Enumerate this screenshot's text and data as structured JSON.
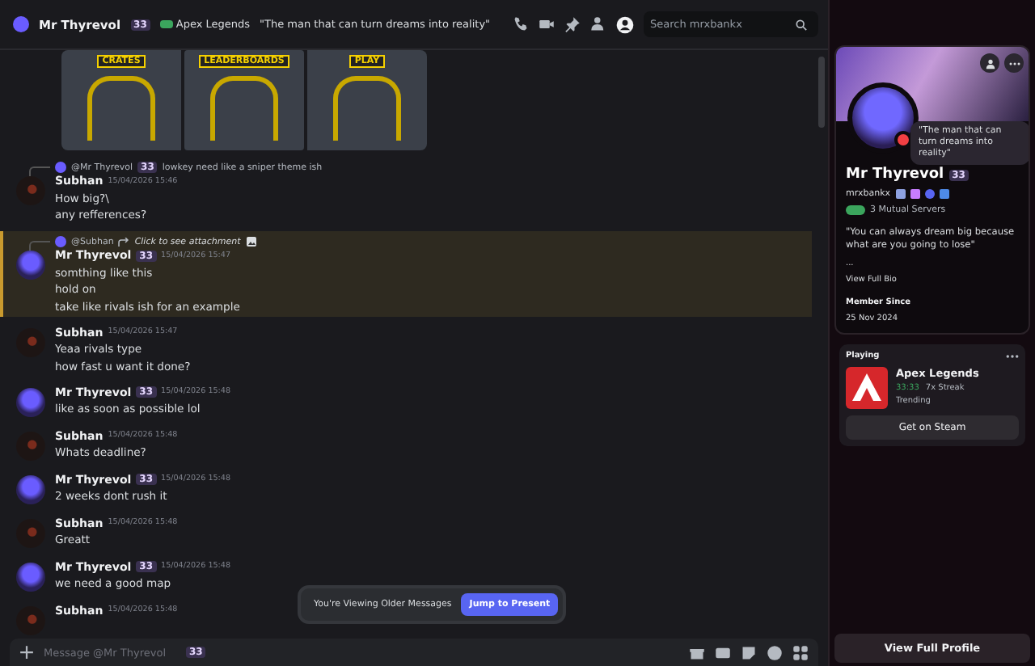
{
  "header": {
    "name": "Mr Thyrevol",
    "tag": "33",
    "game": "Apex Legends",
    "status": "\"The man that can turn dreams into reality\"",
    "search": {
      "placeholder": "Search mrxbankx"
    }
  },
  "attachments": [
    {
      "caption": "CRATES"
    },
    {
      "caption": "LEADERBOARDS"
    },
    {
      "caption": "PLAY"
    }
  ],
  "messages": [
    {
      "author": "Subhan",
      "kind": "dark",
      "time": "15/04/2026 15:46",
      "highlighted": false,
      "reply": {
        "author": "@Mr Thyrevol",
        "tag": "33",
        "text": "lowkey need like a sniper theme ish",
        "kind": "text"
      },
      "lines": [
        "How big?\\",
        "any refferences?"
      ]
    },
    {
      "author": "Mr Thyrevol",
      "kind": "purple",
      "tag": "33",
      "time": "15/04/2026 15:47",
      "highlighted": true,
      "reply": {
        "author": "@Subhan",
        "text": "Click to see attachment",
        "kind": "attachment"
      },
      "lines": [
        "somthing like this",
        "hold on",
        "take like rivals ish for an example"
      ]
    },
    {
      "author": "Subhan",
      "kind": "dark",
      "time": "15/04/2026 15:47",
      "highlighted": false,
      "lines": [
        "Yeaa rivals type",
        "how fast u want it done?"
      ]
    },
    {
      "author": "Mr Thyrevol",
      "kind": "purple",
      "tag": "33",
      "time": "15/04/2026 15:48",
      "highlighted": false,
      "lines": [
        "like as soon as possible lol"
      ]
    },
    {
      "author": "Subhan",
      "kind": "dark",
      "time": "15/04/2026 15:48",
      "highlighted": false,
      "lines": [
        "Whats deadline?"
      ]
    },
    {
      "author": "Mr Thyrevol",
      "kind": "purple",
      "tag": "33",
      "time": "15/04/2026 15:48",
      "highlighted": false,
      "lines": [
        "2 weeks dont rush it"
      ]
    },
    {
      "author": "Subhan",
      "kind": "dark",
      "time": "15/04/2026 15:48",
      "highlighted": false,
      "lines": [
        "Greatt"
      ]
    },
    {
      "author": "Mr Thyrevol",
      "kind": "purple",
      "tag": "33",
      "time": "15/04/2026 15:48",
      "highlighted": false,
      "lines": [
        "we need a good map"
      ]
    },
    {
      "author": "Subhan",
      "kind": "dark",
      "time": "15/04/2026 15:48",
      "highlighted": false
    }
  ],
  "older_notice": {
    "text": "You're Viewing Older Messages",
    "button": "Jump to Present"
  },
  "composer": {
    "placeholder": "Message @Mr Thyrevol",
    "tag": "33"
  },
  "profile": {
    "status": "\"The man that can turn dreams into reality\"",
    "name": "Mr Thyrevol",
    "tag": "33",
    "username": "mrxbankx",
    "mutual": "3 Mutual Servers",
    "bio": "\"You can always dream big because what are you going to lose\"",
    "bio_more": "...",
    "view_bio": "View Full Bio",
    "member_since_label": "Member Since",
    "member_since": "25 Nov 2024",
    "activity": {
      "label": "Playing",
      "game": "Apex Legends",
      "elapsed": "33:33",
      "streak": "7x Streak",
      "trending": "Trending",
      "button": "Get on Steam"
    },
    "full_profile": "View Full Profile"
  }
}
